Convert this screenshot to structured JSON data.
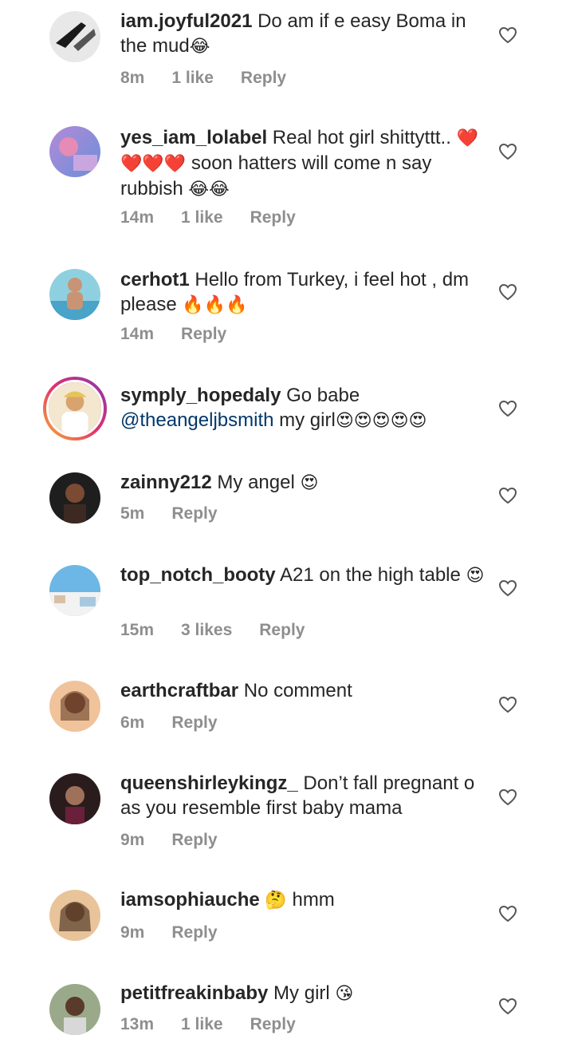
{
  "colors": {
    "username": "#262626",
    "meta": "#8e8e8e",
    "mention": "#00376b"
  },
  "comments": [
    {
      "username": "iam.joyful2021",
      "text_before": " Do am if e easy Boma in the mud",
      "emoji": "😂",
      "time": "8m",
      "likes": "1 like",
      "reply": "Reply"
    },
    {
      "username": "yes_iam_lolabel",
      "text_before": " Real hot girl shittyttt.. ",
      "emoji": "❤️❤️❤️❤️",
      "text_after": " soon hatters will come n say rubbish ",
      "emoji2": "😂😂",
      "time": "14m",
      "likes": "1 like",
      "reply": "Reply"
    },
    {
      "username": "cerhot1",
      "text_before": " Hello from Turkey, i feel hot , dm please ",
      "emoji": "🔥🔥🔥",
      "time": "14m",
      "reply": "Reply"
    },
    {
      "username": "symply_hopedaly",
      "text_before": " Go babe ",
      "mention": "@theangeljbsmith",
      "text_after": " my girl",
      "emoji": "😍😍😍😍😍"
    },
    {
      "username": "zainny212",
      "text_before": " My angel ",
      "emoji": "😍",
      "time": "5m",
      "reply": "Reply"
    },
    {
      "username": "top_notch_booty",
      "text_before": " A21 on the high table ",
      "emoji": "😍",
      "time": "15m",
      "likes": "3 likes",
      "reply": "Reply"
    },
    {
      "username": "earthcraftbar",
      "text_before": " No comment",
      "time": "6m",
      "reply": "Reply"
    },
    {
      "username": "queenshirleykingz_",
      "text_before": " Don’t fall pregnant o as you resemble first baby mama",
      "time": "9m",
      "reply": "Reply"
    },
    {
      "username": "iamsophiauche",
      "text_before": " ",
      "emoji": "🤔",
      "text_after": " hmm",
      "time": "9m",
      "reply": "Reply"
    },
    {
      "username": "petitfreakinbaby",
      "text_before": " My girl ",
      "emoji": "😘",
      "time": "13m",
      "likes": "1 like",
      "reply": "Reply"
    }
  ]
}
